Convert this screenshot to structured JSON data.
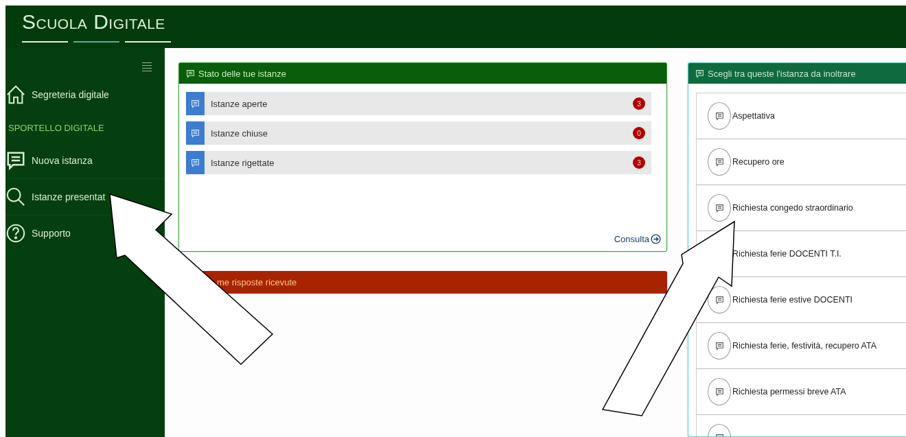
{
  "header": {
    "logo": "Scuola Digitale"
  },
  "sidebar": {
    "items": [
      {
        "kind": "link",
        "label": "Segreteria digitale"
      },
      {
        "kind": "section",
        "label": "SPORTELLO DIGITALE"
      },
      {
        "kind": "link",
        "label": "Nuova istanza"
      },
      {
        "kind": "link",
        "label": "Istanze presentat"
      },
      {
        "kind": "link",
        "label": "Supporto"
      }
    ]
  },
  "status_panel": {
    "title": "Stato delle tue istanze",
    "rows": [
      {
        "label": "Istanze aperte",
        "count": "3"
      },
      {
        "label": "Istanze chiuse",
        "count": "0"
      },
      {
        "label": "Istanze rigettate",
        "count": "3"
      }
    ],
    "link": "Consulta"
  },
  "replies_panel": {
    "title": "me risposte ricevute"
  },
  "choice_panel": {
    "title": "Scegli tra queste l'istanza da inoltrare",
    "items": [
      {
        "kind": "request",
        "label": "Aspettativa"
      },
      {
        "kind": "request",
        "label": "Recupero ore"
      },
      {
        "kind": "request",
        "label": "Richiesta congedo straordinario"
      },
      {
        "kind": "request_no_icon",
        "label": "Richiesta ferie DOCENTI T.I."
      },
      {
        "kind": "request",
        "label": "Richiesta ferie estive DOCENTI"
      },
      {
        "kind": "request",
        "label": "Richiesta ferie, festività, recupero ATA"
      },
      {
        "kind": "request",
        "label": "Richiesta permessi breve ATA"
      },
      {
        "kind": "partial"
      }
    ]
  }
}
